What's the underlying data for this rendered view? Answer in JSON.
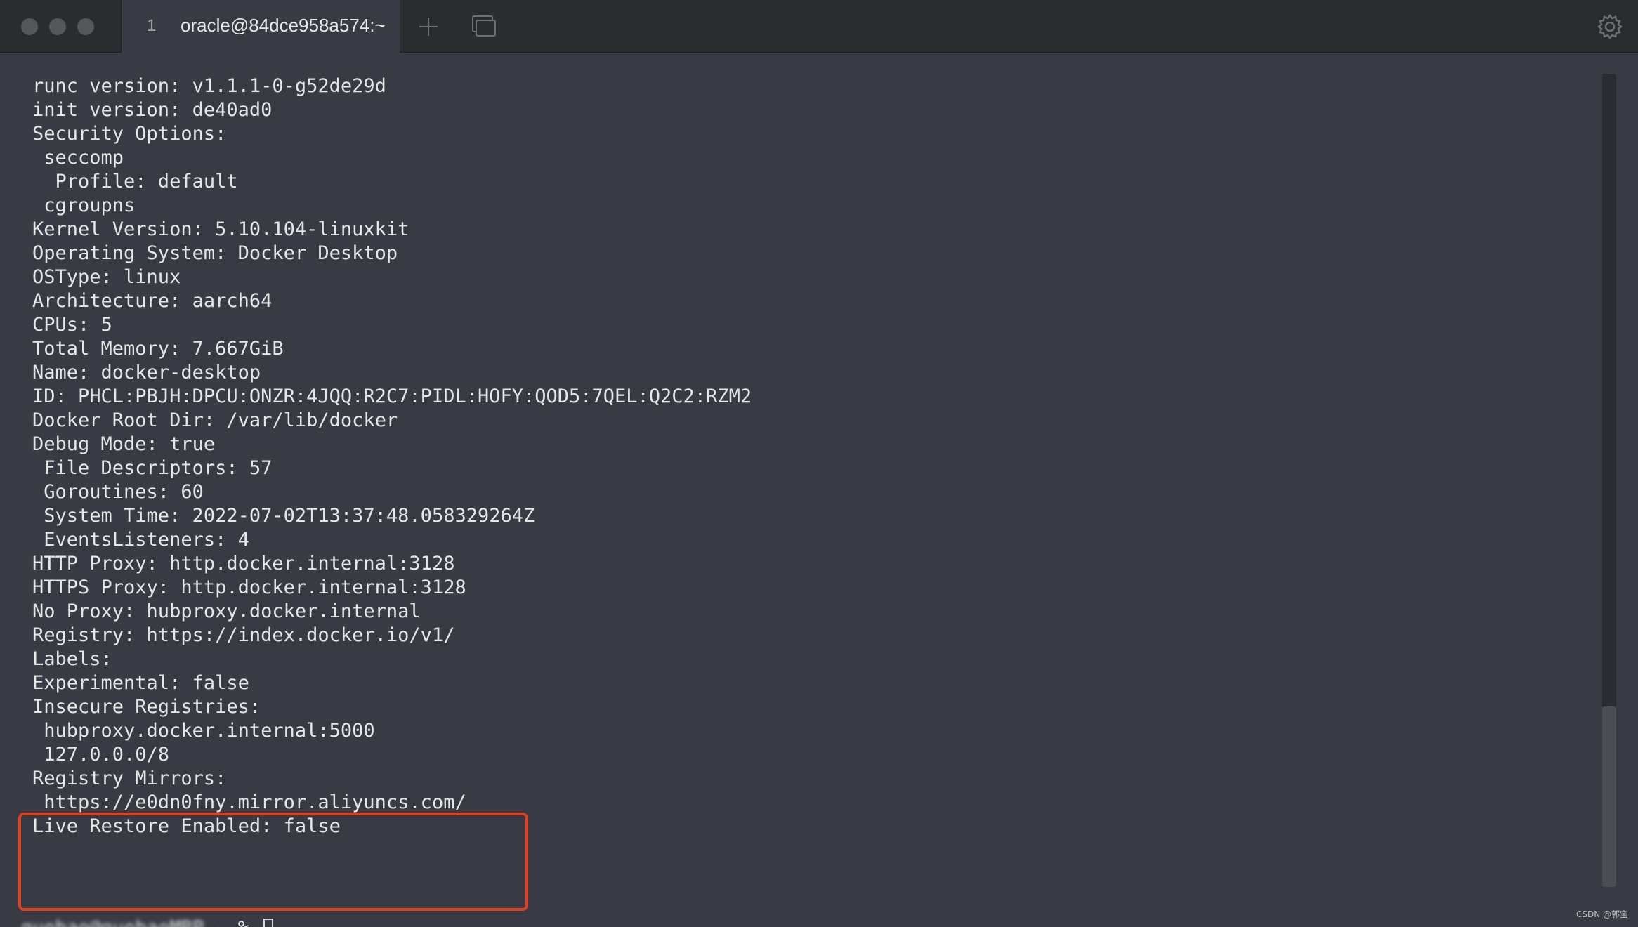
{
  "window": {
    "tab": {
      "number": "1",
      "title": "oracle@84dce958a574:~"
    },
    "icons": [
      "close-icon",
      "minimize-icon",
      "maximize-icon",
      "plus-icon",
      "tabs-overview-icon",
      "gear-icon"
    ]
  },
  "terminal": {
    "lines": [
      "runc version: v1.1.1-0-g52de29d",
      "init version: de40ad0",
      "Security Options:",
      " seccomp",
      "  Profile: default",
      " cgroupns",
      "Kernel Version: 5.10.104-linuxkit",
      "Operating System: Docker Desktop",
      "OSType: linux",
      "Architecture: aarch64",
      "CPUs: 5",
      "Total Memory: 7.667GiB",
      "Name: docker-desktop",
      "ID: PHCL:PBJH:DPCU:ONZR:4JQQ:R2C7:PIDL:HOFY:QOD5:7QEL:Q2C2:RZM2",
      "Docker Root Dir: /var/lib/docker",
      "Debug Mode: true",
      " File Descriptors: 57",
      " Goroutines: 60",
      " System Time: 2022-07-02T13:37:48.058329264Z",
      " EventsListeners: 4",
      "HTTP Proxy: http.docker.internal:3128",
      "HTTPS Proxy: http.docker.internal:3128",
      "No Proxy: hubproxy.docker.internal",
      "Registry: https://index.docker.io/v1/",
      "Labels:",
      "Experimental: false",
      "Insecure Registries:",
      " hubproxy.docker.internal:5000",
      " 127.0.0.0/8",
      "Registry Mirrors:",
      " https://e0dn0fny.mirror.aliyuncs.com/",
      "Live Restore Enabled: false"
    ],
    "prompt": {
      "user_host": "guobao@guobaoMBP",
      "suffix": " ~ % "
    },
    "scroll_position": 0.78
  },
  "watermark": "CSDN @郭宝",
  "colors": {
    "background": "#383b43",
    "tabbar": "#2b2c30",
    "text": "#e6e6e6",
    "highlight": "#e0401f"
  }
}
